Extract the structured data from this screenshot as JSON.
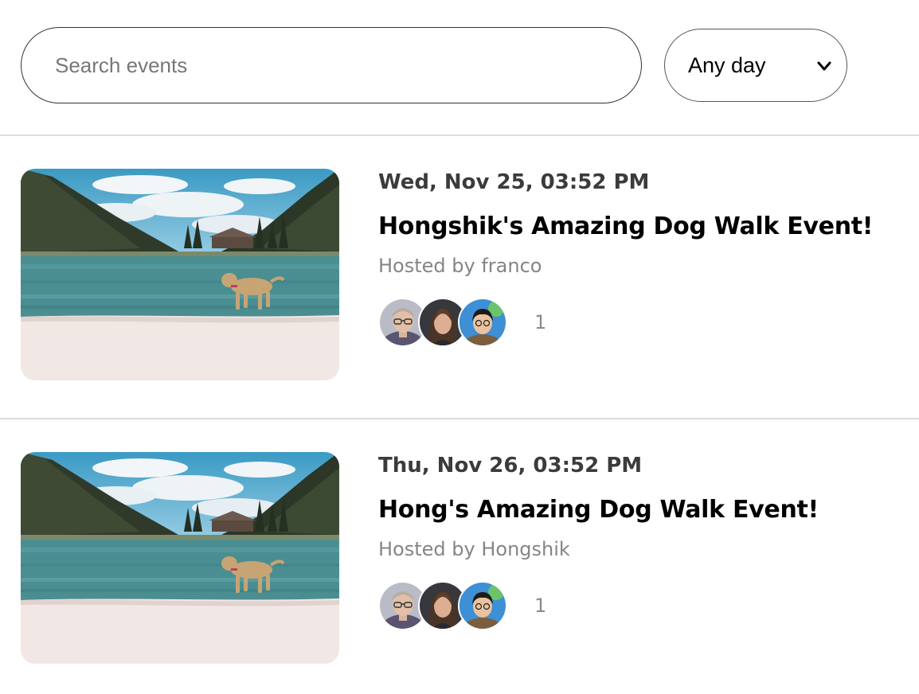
{
  "search": {
    "placeholder": "Search events",
    "value": ""
  },
  "day_filter": {
    "selected": "Any day",
    "icon": "chevron-down-icon"
  },
  "events": [
    {
      "date": "Wed, Nov 25, 03:52 PM",
      "title": "Hongshik's Amazing Dog Walk Event!",
      "host": "Hosted by franco",
      "attendee_count": "1",
      "image": "dog-on-lake-beach-photo",
      "avatars": [
        "avatar-man-glasses",
        "avatar-woman-long-hair",
        "avatar-man-blue-background"
      ]
    },
    {
      "date": "Thu, Nov 26, 03:52 PM",
      "title": "Hong's Amazing Dog Walk Event!",
      "host": "Hosted by Hongshik",
      "attendee_count": "1",
      "image": "dog-on-lake-beach-photo",
      "avatars": [
        "avatar-man-glasses",
        "avatar-woman-long-hair",
        "avatar-man-blue-background"
      ]
    }
  ]
}
